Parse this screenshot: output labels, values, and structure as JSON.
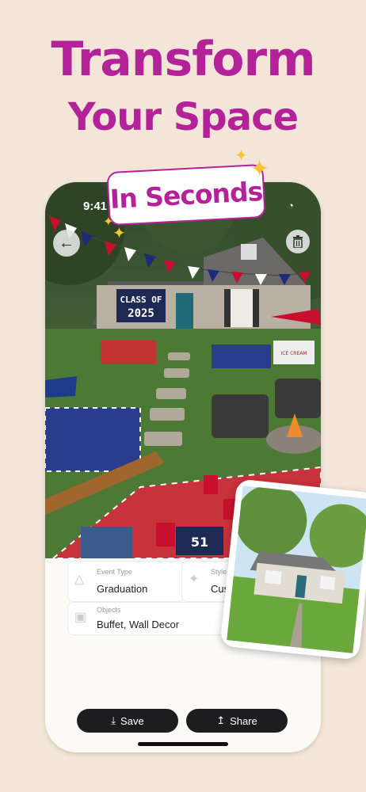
{
  "headline": {
    "line1": "Transform",
    "line2": "Your Space",
    "tag": "In Seconds"
  },
  "status_bar": {
    "time": "9:41"
  },
  "scene": {
    "banner_line1": "CLASS OF",
    "banner_line2": "2025",
    "cart_label": "ICE CREAM",
    "shirt_number": "51"
  },
  "details": {
    "event_type_label": "Event Type",
    "event_type_value": "Graduation",
    "style_label": "Style",
    "style_value": "Cust",
    "objects_label": "Objects",
    "objects_value": "Buffet, Wall Decor"
  },
  "actions": {
    "save_label": "Save",
    "share_label": "Share"
  },
  "colors": {
    "brand": "#b4229a",
    "button": "#1d1d1f",
    "background": "#f3e6d8"
  }
}
